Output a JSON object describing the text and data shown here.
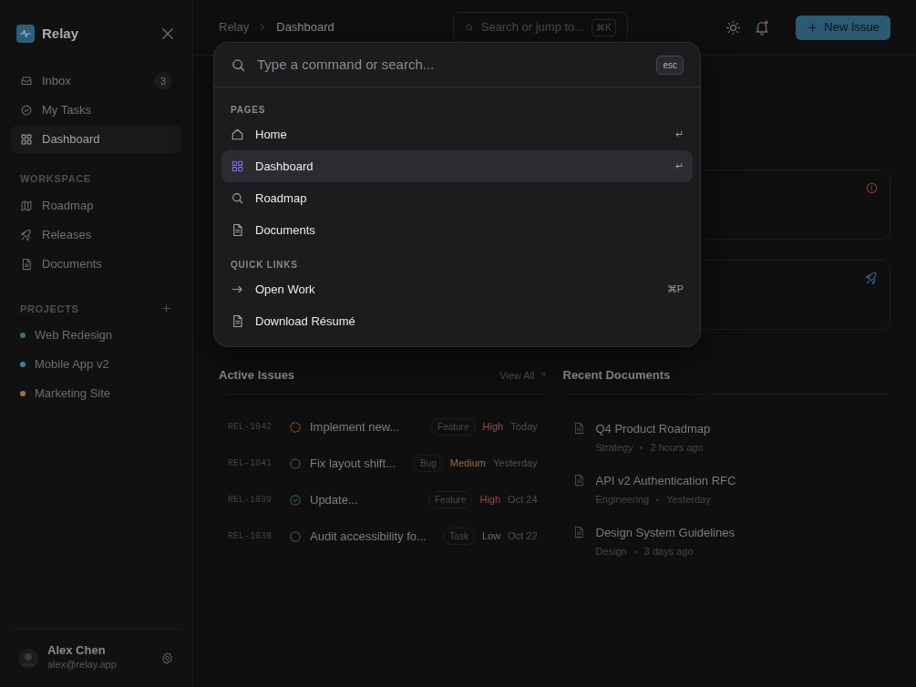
{
  "sidebar": {
    "brand": "Relay",
    "nav": [
      {
        "kind": "inbox",
        "label": "Inbox",
        "badge": "3",
        "selected": false
      },
      {
        "kind": "check",
        "label": "My Tasks",
        "selected": false
      },
      {
        "kind": "grid",
        "label": "Dashboard",
        "selected": true
      }
    ],
    "workspace": {
      "heading": "WORKSPACE",
      "items": [
        {
          "kind": "map",
          "label": "Roadmap",
          "selected": false
        },
        {
          "kind": "rocket",
          "label": "Releases",
          "selected": false
        },
        {
          "kind": "file",
          "label": "Documents",
          "selected": false
        }
      ]
    },
    "projects": {
      "heading": "PROJECTS",
      "items": [
        {
          "label": "Web Redesign",
          "color": "#3f7a4f"
        },
        {
          "label": "Mobile App v2",
          "color": "#3b7fa8"
        },
        {
          "label": "Marketing Site",
          "color": "#b0703a"
        }
      ]
    },
    "user": {
      "name": "Alex Chen",
      "email": "alex@relay.app"
    }
  },
  "header": {
    "breadcrumb": [
      "Relay",
      "Dashboard"
    ],
    "search": {
      "placeholder": "Search or jump to...",
      "shortcut": "⌘K"
    },
    "unread": true,
    "new_button": "New Issue"
  },
  "cards": [
    {
      "kind": "alert"
    },
    {
      "kind": "rocket"
    }
  ],
  "active_issues": {
    "title": "Active Issues",
    "view_all": "View All",
    "rows": [
      {
        "id": "REL-1042",
        "kind": "in_progress",
        "title": "Implement new...",
        "tag": "Feature",
        "priority": "High",
        "color": "#9a4a4a",
        "date": "Today"
      },
      {
        "id": "REL-1041",
        "kind": "todo",
        "title": "Fix layout shift...",
        "tag": "Bug",
        "priority": "Medium",
        "color": "#a06a2e",
        "date": "Yesterday"
      },
      {
        "id": "REL-1039",
        "kind": "done",
        "title": "Update...",
        "tag": "Feature",
        "priority": "High",
        "color": "#9a4a4a",
        "date": "Oct 24"
      },
      {
        "id": "REL-1038",
        "kind": "todo",
        "title": "Audit accessibility fo...",
        "tag": "Task",
        "priority": "Low",
        "color": "#6e6e72",
        "date": "Oct 22"
      }
    ]
  },
  "recent_documents": {
    "title": "Recent Documents",
    "items": [
      {
        "title": "Q4 Product Roadmap",
        "category": "Strategy",
        "time": "2 hours ago"
      },
      {
        "title": "API v2 Authentication RFC",
        "category": "Engineering",
        "time": "Yesterday"
      },
      {
        "title": "Design System Guidelines",
        "category": "Design",
        "time": "3 days ago"
      }
    ]
  },
  "palette": {
    "placeholder": "Type a command or search...",
    "esc": "esc",
    "groups": [
      {
        "label": "PAGES",
        "items": [
          {
            "kind": "home",
            "label": "Home",
            "shortcut": "↵",
            "selected": false
          },
          {
            "kind": "grid",
            "label": "Dashboard",
            "shortcut": "↵",
            "selected": true
          },
          {
            "kind": "search",
            "label": "Roadmap",
            "selected": false
          },
          {
            "kind": "file",
            "label": "Documents",
            "selected": false
          }
        ]
      },
      {
        "label": "QUICK LINKS",
        "items": [
          {
            "kind": "arrow",
            "label": "Open Work",
            "shortcut": "⌘P",
            "selected": false
          },
          {
            "kind": "file",
            "label": "Download Résumé",
            "selected": false
          }
        ]
      }
    ]
  }
}
